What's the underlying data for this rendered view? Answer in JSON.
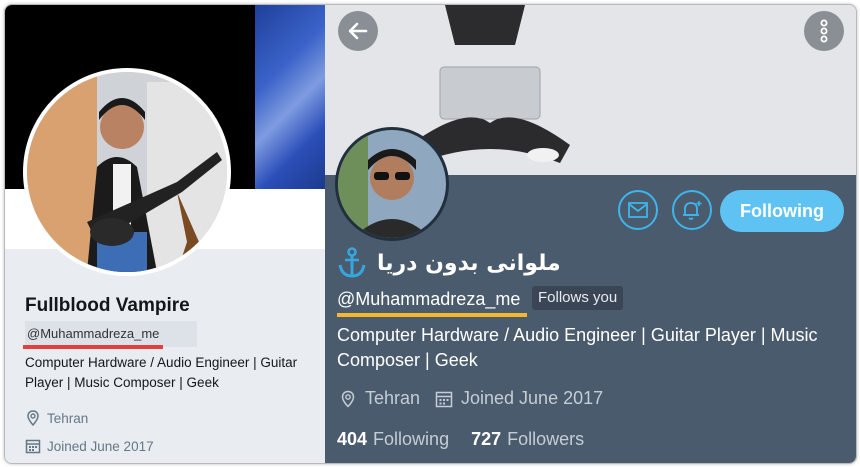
{
  "left": {
    "name": "Fullblood Vampire",
    "handle": "@Muhammadreza_me",
    "bio": "Computer Hardware / Audio Engineer | Guitar Player | Music Composer | Geek",
    "location": "Tehran",
    "joined": "Joined June 2017",
    "icons": {
      "location": "location-pin-icon",
      "calendar": "calendar-icon"
    }
  },
  "right": {
    "display_name": "ملوانی بدون دریا",
    "handle": "@Muhammadreza_me",
    "follows_you": "Follows you",
    "bio": "Computer Hardware / Audio Engineer | Guitar Player | Music Composer | Geek",
    "location": "Tehran",
    "joined": "Joined June 2017",
    "following_count": "404",
    "following_label": "Following",
    "followers_count": "727",
    "followers_label": "Followers",
    "follow_button": "Following",
    "icons": {
      "back": "back-arrow-icon",
      "more": "more-vertical-icon",
      "message": "envelope-icon",
      "notify": "bell-plus-icon",
      "anchor": "anchor-icon"
    }
  },
  "colors": {
    "accent_blue": "#5ec3f2",
    "dark_panel": "#4b5b6e",
    "handle_underline_left": "#e0403f",
    "handle_underline_right": "#f3b82e"
  }
}
